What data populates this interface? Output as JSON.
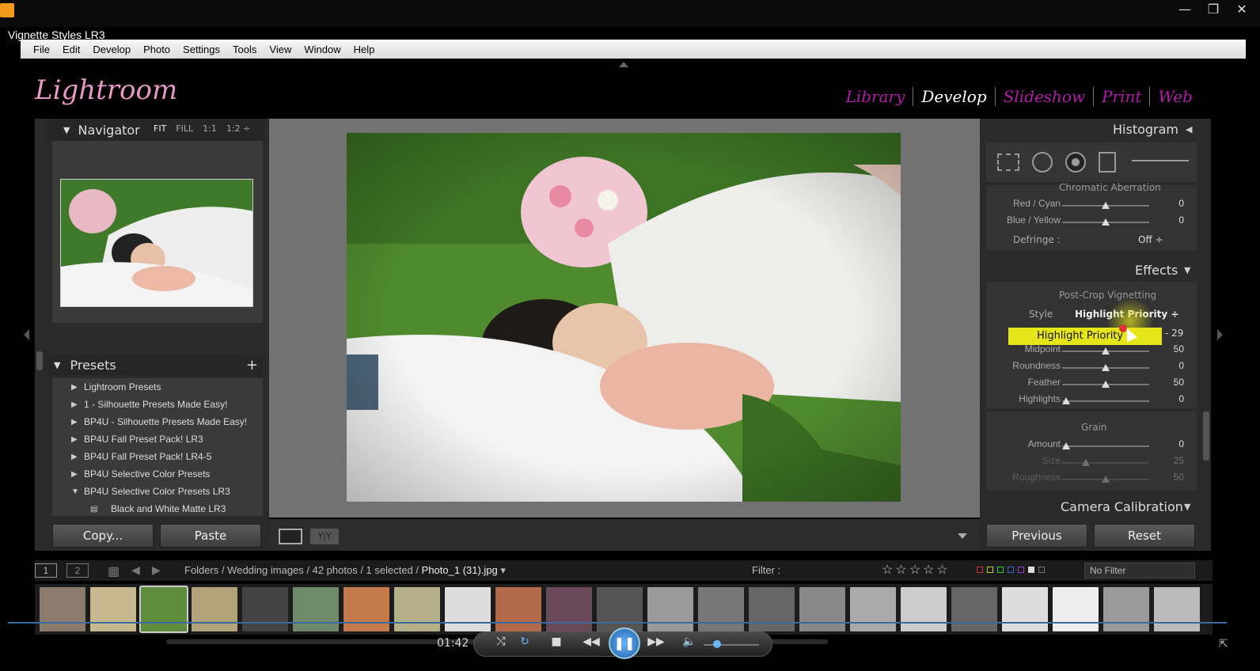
{
  "player": {
    "title": "Vignette Styles LR3",
    "time": "01:42"
  },
  "menu": [
    "File",
    "Edit",
    "Develop",
    "Photo",
    "Settings",
    "Tools",
    "View",
    "Window",
    "Help"
  ],
  "app": {
    "logo": "Lightroom",
    "modules": [
      "Library",
      "Develop",
      "Slideshow",
      "Print",
      "Web"
    ],
    "active_module": "Develop"
  },
  "navigator": {
    "title": "Navigator",
    "zoom": [
      "FIT",
      "FILL",
      "1:1",
      "1:2 ÷"
    ]
  },
  "presets": {
    "title": "Presets",
    "items": [
      {
        "label": "Lightroom Presets",
        "state": "▶"
      },
      {
        "label": "1 - Silhouette Presets Made Easy!",
        "state": "▶"
      },
      {
        "label": "BP4U - Silhouette Presets Made Easy!",
        "state": "▶"
      },
      {
        "label": "BP4U Fall Preset Pack! LR3",
        "state": "▶"
      },
      {
        "label": "BP4U Fall Preset Pack! LR4-5",
        "state": "▶"
      },
      {
        "label": "BP4U Selective Color Presets",
        "state": "▶"
      },
      {
        "label": "BP4U Selective Color Presets LR3",
        "state": "▼"
      },
      {
        "label": "Black and White Matte LR3",
        "state": ""
      }
    ],
    "copy_label": "Copy...",
    "paste_label": "Paste"
  },
  "right": {
    "histogram": "Histogram",
    "chromatic": "Chromatic Aberration",
    "red_cyan": {
      "label": "Red / Cyan",
      "value": "0"
    },
    "blue_yellow": {
      "label": "Blue / Yellow",
      "value": "0"
    },
    "defringe": {
      "label": "Defringe :",
      "value": "Off ÷"
    },
    "effects": "Effects",
    "post_crop": "Post-Crop Vignetting",
    "style": {
      "label": "Style",
      "value": "Highlight Priority ÷"
    },
    "dropdown": "Highlight Priority",
    "amount_val": "- 29",
    "midpoint": {
      "label": "Midpoint",
      "value": "50"
    },
    "roundness": {
      "label": "Roundness",
      "value": "0"
    },
    "feather": {
      "label": "Feather",
      "value": "50"
    },
    "highlights": {
      "label": "Highlights",
      "value": "0"
    },
    "grain": "Grain",
    "g_amount": {
      "label": "Amount",
      "value": "0"
    },
    "g_size": {
      "label": "Size",
      "value": "25"
    },
    "g_rough": {
      "label": "Roughness",
      "value": "50"
    },
    "camera_cal": "Camera Calibration",
    "previous_label": "Previous",
    "reset_label": "Reset"
  },
  "filmbar": {
    "page1": "1",
    "page2": "2",
    "path": "Folders / Wedding images / 42 photos / 1 selected / ",
    "file": "Photo_1 (31).jpg",
    "filter_label": "Filter :",
    "no_filter": "No Filter"
  },
  "colors": {
    "accent": "#b21ca8",
    "lr_logo": "#e59ac5",
    "dropdown": "#e6e51a"
  }
}
